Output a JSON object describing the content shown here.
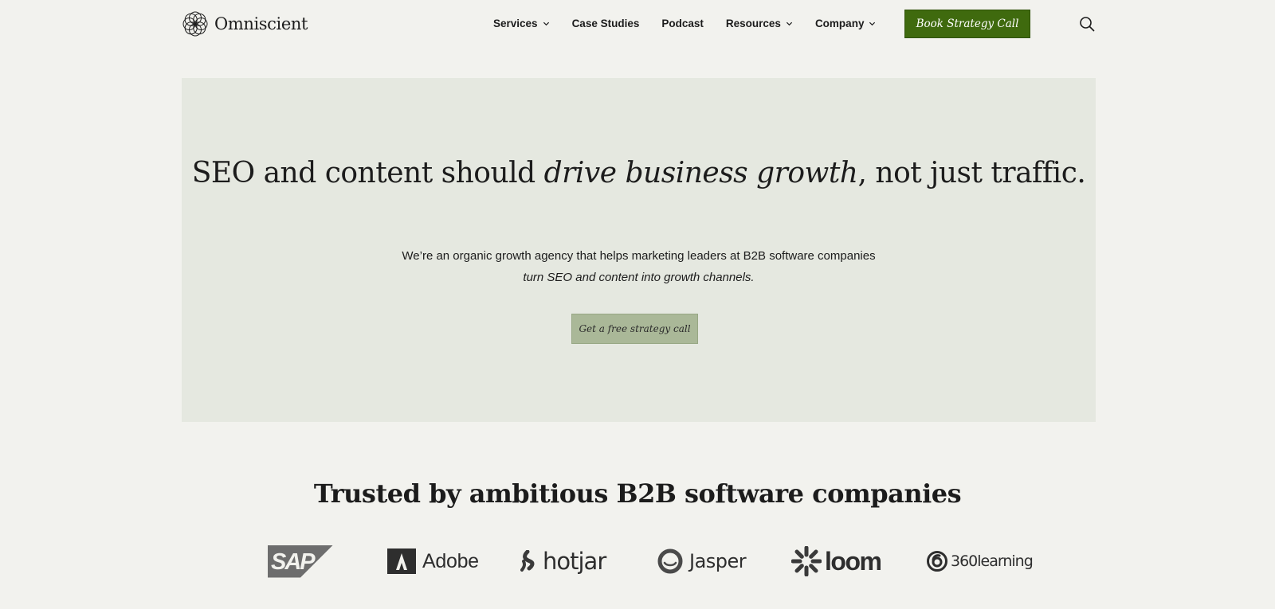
{
  "header": {
    "logo_text": "Omniscient",
    "nav": [
      {
        "label": "Services",
        "has_dropdown": true
      },
      {
        "label": "Case Studies",
        "has_dropdown": false
      },
      {
        "label": "Podcast",
        "has_dropdown": false
      },
      {
        "label": "Resources",
        "has_dropdown": true
      },
      {
        "label": "Company",
        "has_dropdown": true
      }
    ],
    "cta_label": "Book Strategy Call",
    "search_icon": "search-icon"
  },
  "hero": {
    "title_part1": "SEO and content should ",
    "title_em": "drive business growth",
    "title_part2": ", not just traffic.",
    "subtitle_line1": "We’re an organic growth agency that helps marketing leaders at B2B software companies",
    "subtitle_line2": "turn SEO and content into growth channels.",
    "cta_label": "Get a free strategy call"
  },
  "trusted": {
    "title": "Trusted by ambitious B2B software companies",
    "logos": [
      {
        "name": "SAP",
        "icon": "sap-logo"
      },
      {
        "name": "Adobe",
        "icon": "adobe-logo"
      },
      {
        "name": "hotjar",
        "icon": "hotjar-logo"
      },
      {
        "name": "Jasper",
        "icon": "jasper-logo"
      },
      {
        "name": "loom",
        "icon": "loom-logo"
      },
      {
        "name": "360learning",
        "icon": "360learning-logo"
      }
    ]
  },
  "colors": {
    "page_bg": "#f2f2ee",
    "hero_bg": "#e5e8e0",
    "primary_cta": "#3f6a0e",
    "secondary_cta": "#aab898",
    "text": "#1c1c1c"
  }
}
